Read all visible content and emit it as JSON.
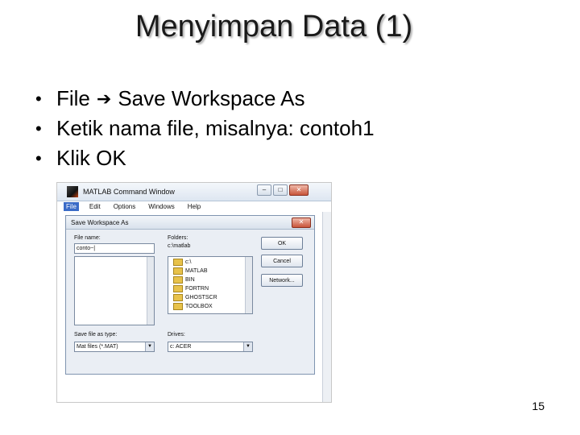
{
  "slide": {
    "title": "Menyimpan Data (1)",
    "bullets": [
      {
        "text_before": "File",
        "text_after": "Save Workspace As"
      },
      {
        "text": "Ketik nama file, misalnya: contoh1"
      },
      {
        "text": "Klik OK"
      }
    ],
    "page_number": "15"
  },
  "screenshot": {
    "window_title": "MATLAB Command Window",
    "menu": [
      "File",
      "Edit",
      "Options",
      "Windows",
      "Help"
    ],
    "active_menu": "File",
    "dialog": {
      "title": "Save Workspace As",
      "file_name_label": "File name:",
      "file_name_value": "conto~|",
      "folders_label": "Folders:",
      "folders_path": "c:\\matlab",
      "folders": [
        "c:\\",
        "MATLAB",
        "BIN",
        "FORTRN",
        "GHOSTSCR",
        "TOOLBOX"
      ],
      "ok_label": "OK",
      "cancel_label": "Cancel",
      "network_label": "Network...",
      "save_type_label": "Save file as type:",
      "save_type_value": "Mat files (*.MAT)",
      "drives_label": "Drives:",
      "drives_value": "c: ACER"
    }
  },
  "icons": {
    "arrow": "right-arrow-icon",
    "folder": "folder-icon",
    "matlab_logo": "matlab-logo-icon"
  }
}
